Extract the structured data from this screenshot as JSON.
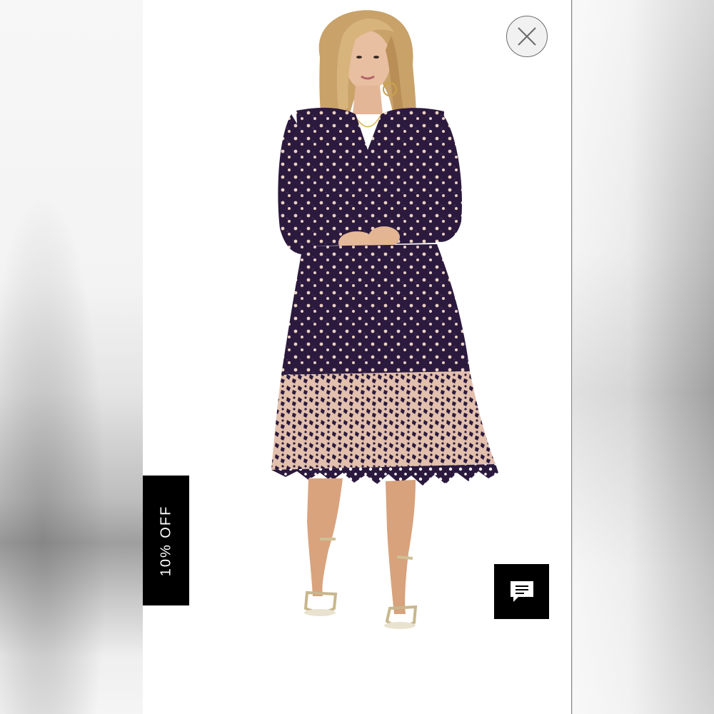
{
  "product": {
    "image_icon": "lace-midi-dress-photo",
    "dress_color": "#2b1a3d"
  },
  "overlay": {
    "close_icon": "close-icon",
    "discount_label": "10% OFF",
    "chat_icon": "chat-bubble-icon"
  },
  "colors": {
    "tab_background": "#000000",
    "tab_text": "#ffffff",
    "panel_background": "#ffffff"
  }
}
